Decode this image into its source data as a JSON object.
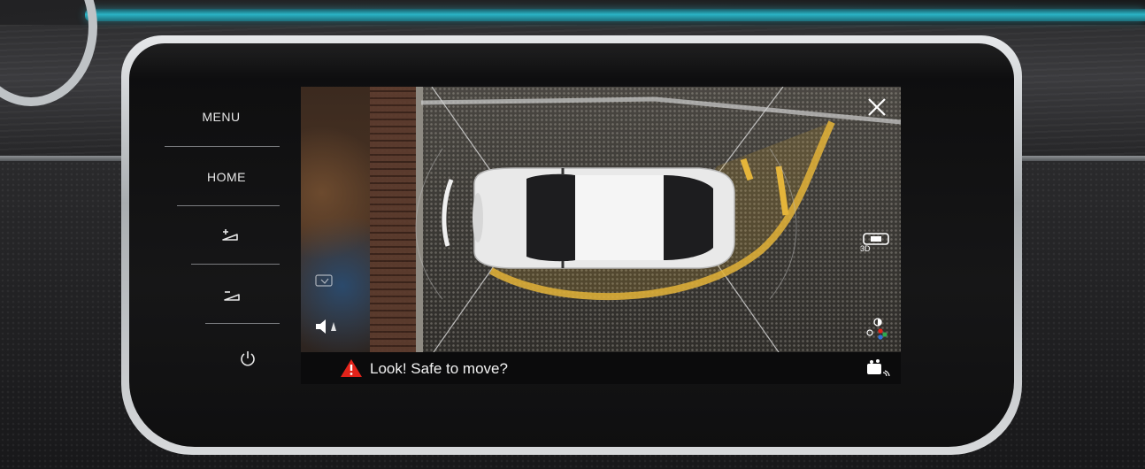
{
  "side_panel": {
    "menu_label": "MENU",
    "home_label": "HOME"
  },
  "screen": {
    "warning_text": "Look! Safe to move?",
    "view_3d_label": "3D"
  },
  "colors": {
    "ambient_light": "#2ab2c4",
    "guide_line": "#e5b53a",
    "warning_red": "#e2231a"
  },
  "icons": [
    "menu-button",
    "home-button",
    "brightness-increase-icon",
    "brightness-decrease-icon",
    "power-icon",
    "close-icon",
    "view-3d-icon",
    "display-settings-icon",
    "mute-icon",
    "parking-view-icon",
    "warning-triangle-icon"
  ]
}
